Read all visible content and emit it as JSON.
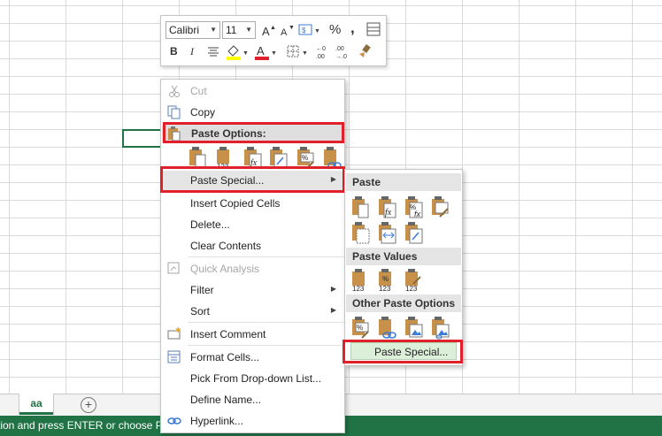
{
  "sheet": {
    "tab_name": "aa",
    "add_symbol": "+"
  },
  "status": {
    "text": "tion and press ENTER or choose Pas"
  },
  "mini_toolbar": {
    "font": "Calibri",
    "size": "11",
    "bold": "B",
    "italic": "I",
    "percent": "%",
    "comma": ",",
    "inc_decimal": ".00 →.0",
    "dec_decimal": ".00 →.0",
    "colors": {
      "highlight": "#ffff00",
      "font_color": "#e0202b"
    }
  },
  "menu": {
    "cut": "Cut",
    "copy": "Copy",
    "paste_options": "Paste Options:",
    "paste_special": "Paste Special...",
    "insert_copied": "Insert Copied Cells",
    "delete": "Delete...",
    "clear": "Clear Contents",
    "quick_analysis": "Quick Analysis",
    "filter": "Filter",
    "sort": "Sort",
    "insert_comment": "Insert Comment",
    "format_cells": "Format Cells...",
    "pick_list": "Pick From Drop-down List...",
    "define_name": "Define Name...",
    "hyperlink": "Hyperlink..."
  },
  "submenu": {
    "paste": "Paste",
    "paste_values": "Paste Values",
    "other": "Other Paste Options",
    "paste_special": "Paste Special..."
  },
  "icon_texts": {
    "n123": "123",
    "fx": "fx",
    "pct": "%"
  },
  "colors": {
    "accent": "#217346",
    "highlight_red": "#e0202b",
    "clip": "#c8914a"
  }
}
